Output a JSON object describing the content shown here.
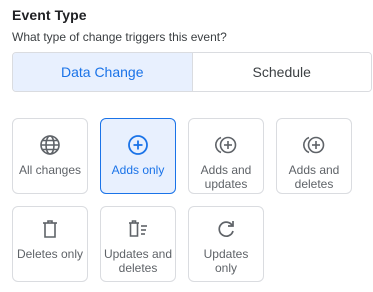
{
  "header": {
    "title": "Event Type",
    "subtitle": "What type of change triggers this event?"
  },
  "segmented": {
    "options": [
      "Data Change",
      "Schedule"
    ],
    "selected": "Data Change"
  },
  "colors": {
    "accent": "#1a73e8",
    "accent_bg": "#e8f0fe",
    "border": "#dadce0",
    "text": "#3c4043"
  },
  "cards": [
    {
      "label": "All changes",
      "icon": "globe-icon",
      "selected": false
    },
    {
      "label": "Adds only",
      "icon": "add-circle-icon",
      "selected": true
    },
    {
      "label": "Adds and updates",
      "icon": "add-update-icon",
      "selected": false
    },
    {
      "label": "Adds and deletes",
      "icon": "add-update-icon",
      "selected": false
    },
    {
      "label": "Deletes only",
      "icon": "trash-icon",
      "selected": false
    },
    {
      "label": "Updates and deletes",
      "icon": "trash-list-icon",
      "selected": false
    },
    {
      "label": "Updates only",
      "icon": "refresh-icon",
      "selected": false
    }
  ]
}
